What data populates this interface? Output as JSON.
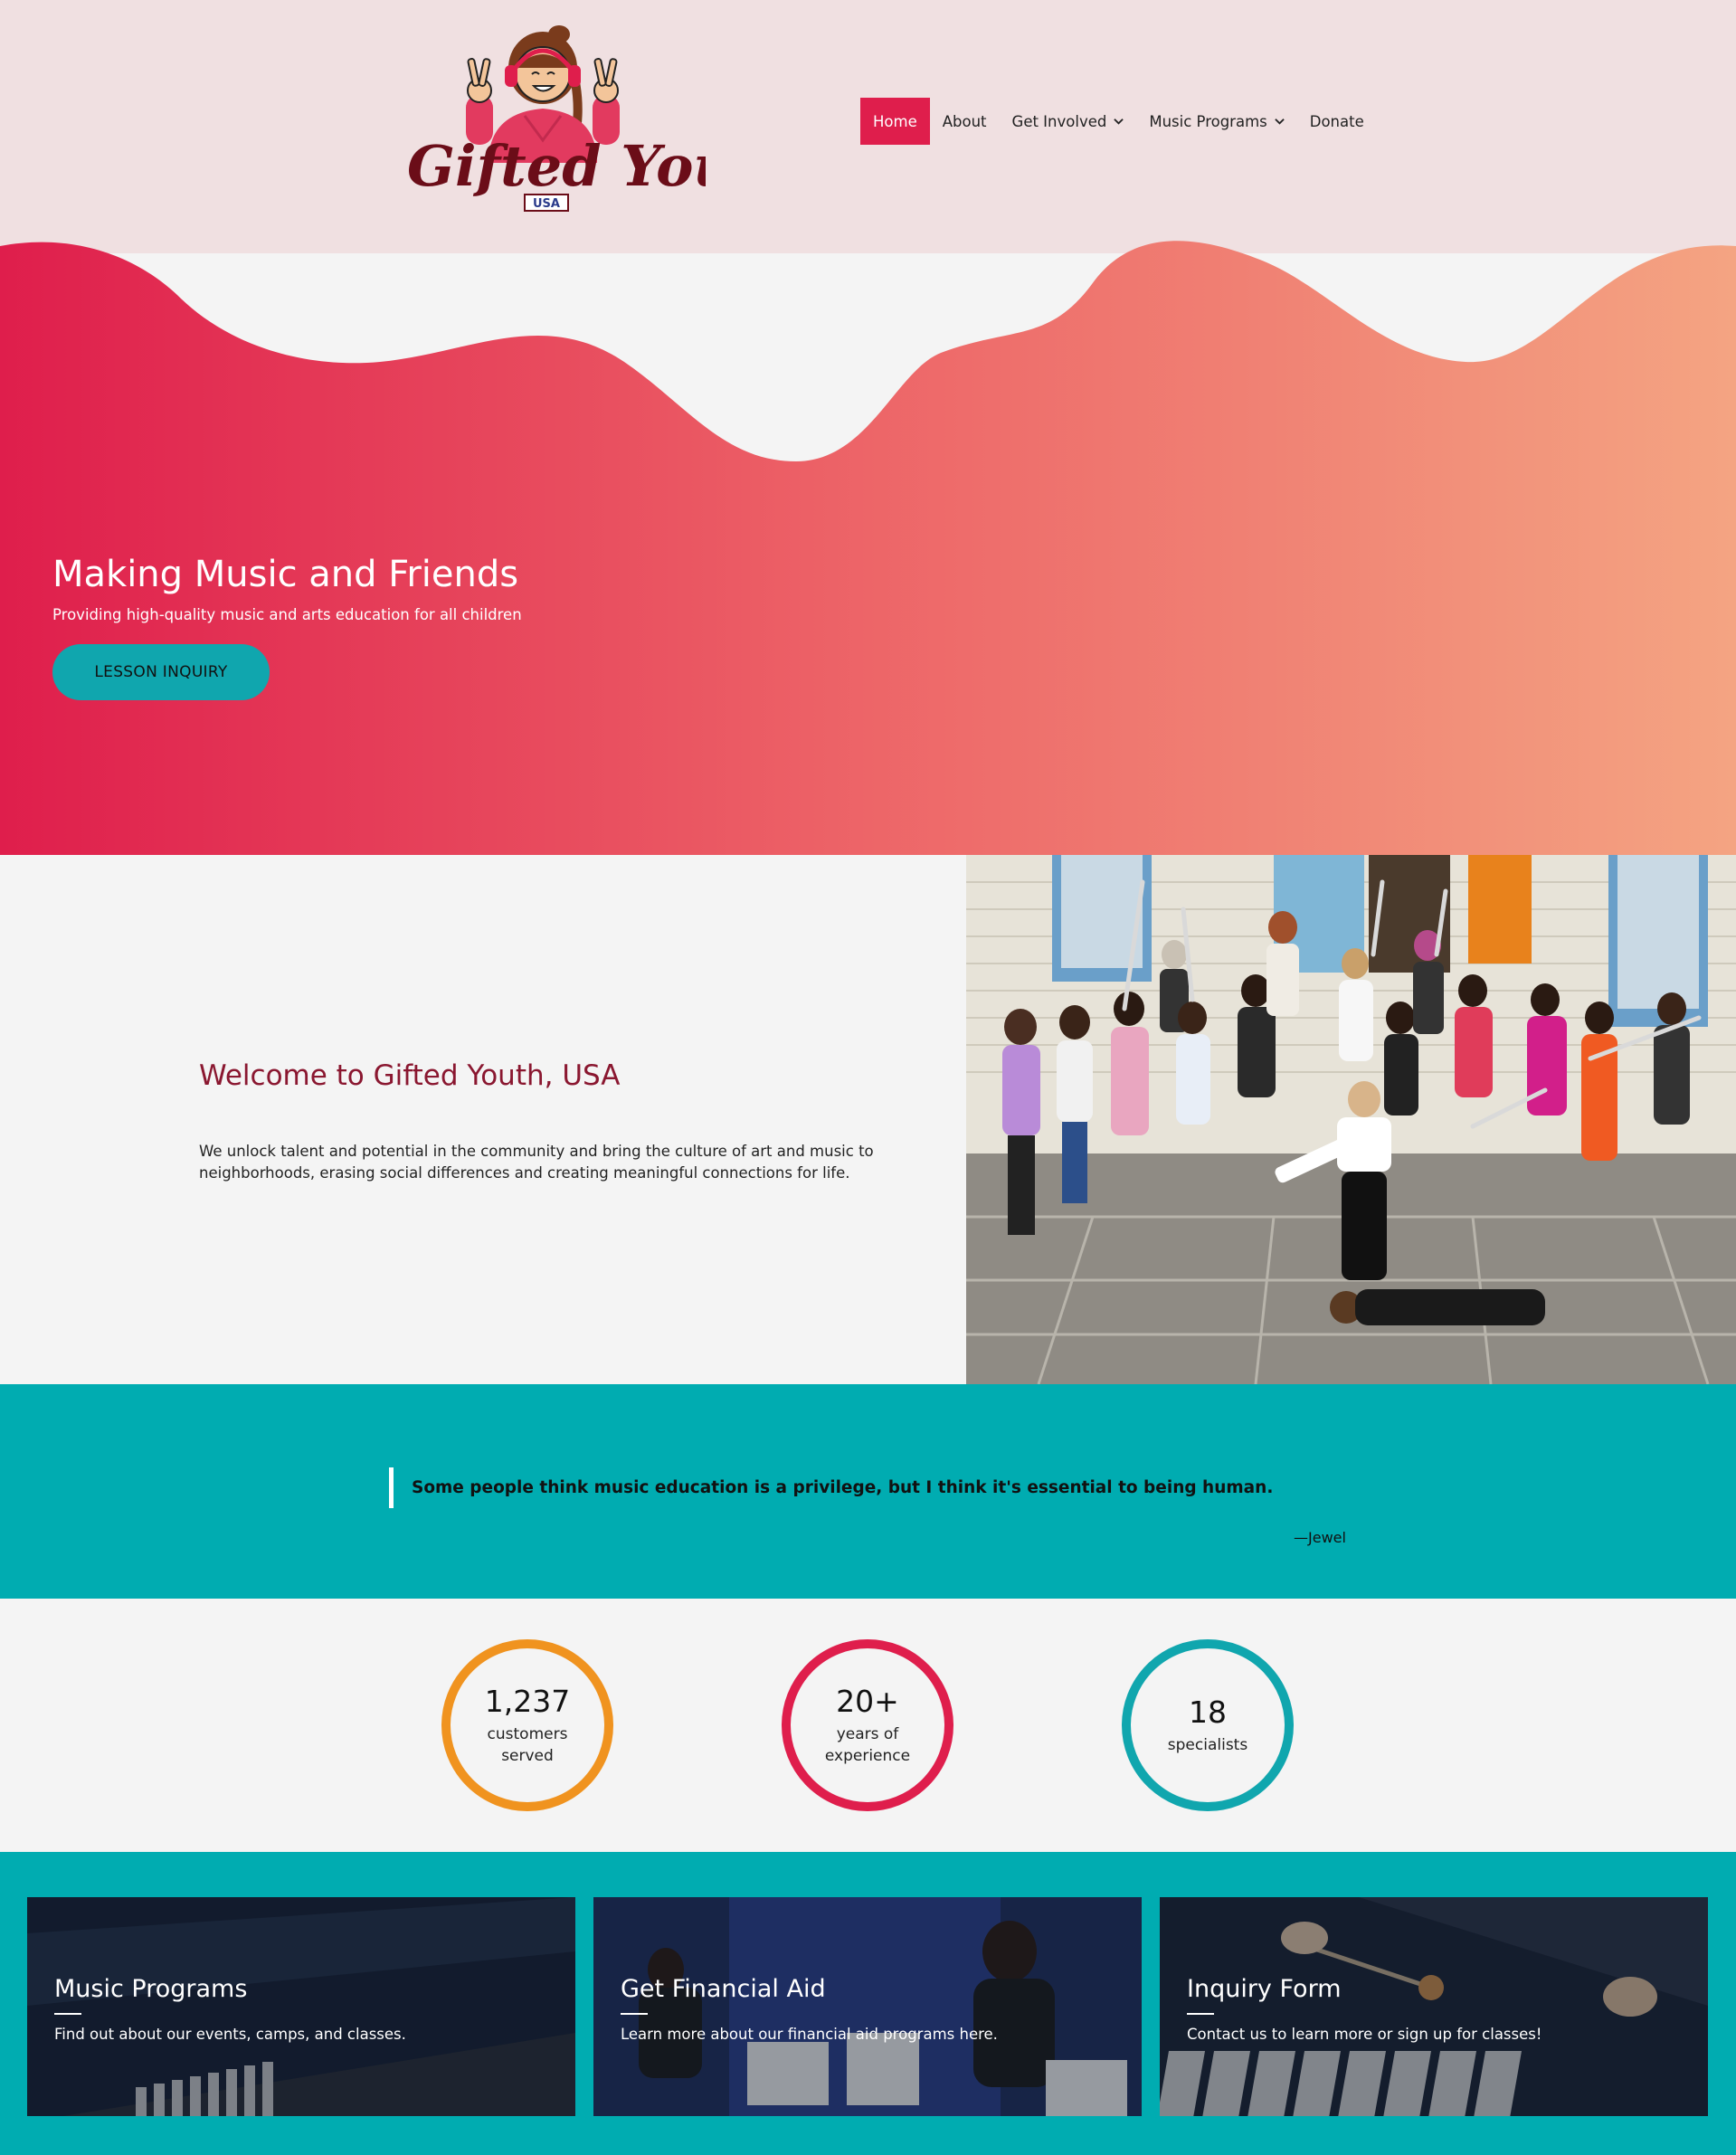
{
  "brand": {
    "logo_text": "Gifted Youth",
    "logo_badge": "USA"
  },
  "nav": {
    "items": [
      {
        "label": "Home",
        "active": true,
        "dropdown": false
      },
      {
        "label": "About",
        "active": false,
        "dropdown": false
      },
      {
        "label": "Get Involved",
        "active": false,
        "dropdown": true
      },
      {
        "label": "Music Programs",
        "active": false,
        "dropdown": true
      },
      {
        "label": "Donate",
        "active": false,
        "dropdown": false
      }
    ]
  },
  "hero": {
    "title": "Making Music and Friends",
    "subtitle": "Providing high-quality music and arts education for all children",
    "button_label": "LESSON INQUIRY"
  },
  "welcome": {
    "heading": "Welcome to Gifted Youth, USA",
    "body": "We unlock talent and potential in the community and bring the culture of art and music to neighborhoods, erasing social differences and creating meaningful connections for life."
  },
  "quote": {
    "text": "Some people think music education is a privilege, but I think it's essential to being human.",
    "author": "—Jewel"
  },
  "stats": [
    {
      "number": "1,237",
      "label": "customers served",
      "color": "#f0931f"
    },
    {
      "number": "20+",
      "label": "years of experience",
      "color": "#df1e4c"
    },
    {
      "number": "18",
      "label": "specialists",
      "color": "#10a6ae"
    }
  ],
  "cards": [
    {
      "title": "Music Programs",
      "description": "Find out about our events, camps, and classes."
    },
    {
      "title": "Get Financial Aid",
      "description": "Learn more about our financial aid programs here."
    },
    {
      "title": "Inquiry Form",
      "description": "Contact us to learn more or sign up for classes!"
    }
  ],
  "colors": {
    "accent": "#df1e4c",
    "teal": "#00acb1",
    "header_bg": "#f0e0e1",
    "gradient_start": "#df1e4c",
    "gradient_end": "#f4a482",
    "heading_maroon": "#8a1730"
  }
}
